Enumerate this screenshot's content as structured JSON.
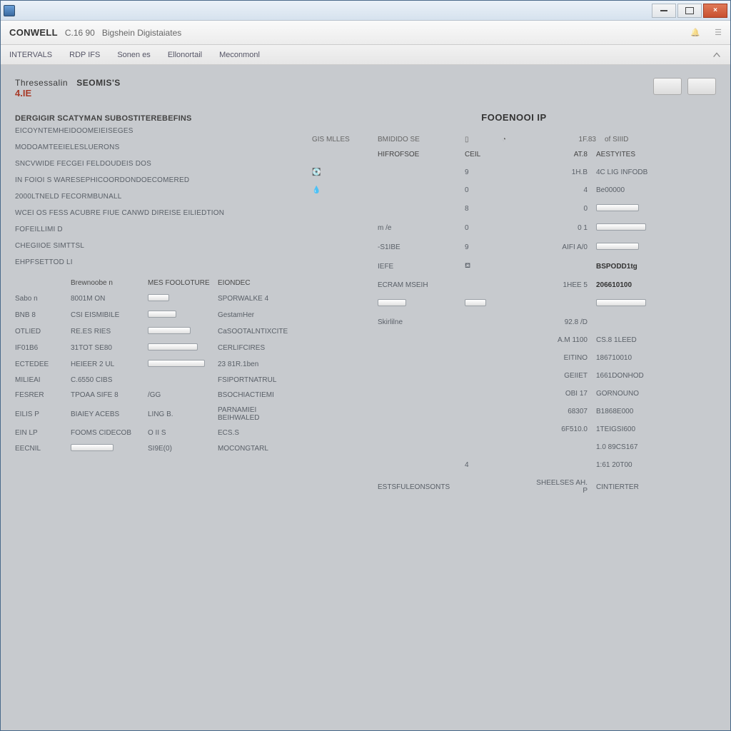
{
  "window": {
    "title": "",
    "titlebar_buttons": {
      "min": "",
      "max": "",
      "close": "×"
    }
  },
  "appheader": {
    "brand": "CONWELL",
    "suffix": "C.16 90",
    "subtitle": "Bigshein Digistaiates"
  },
  "toolstrip": {
    "items": [
      "INTERVALS",
      "RDP IFS",
      "Sonen es",
      "Ellonortail",
      "Meconmonl"
    ]
  },
  "left": {
    "pg_title_a": "Thresessalin",
    "pg_title_b": "SEOMIS'S",
    "accent": "4.IE",
    "section_header": "DERGIGIR  SCATYMAN SUBOSTITEREBEFINS",
    "params": [
      "EICOYNTEMHEIDOOMEIEISEGES",
      "MODOAMTEEIELESLUERONS",
      "SNCVWIDE FECGEI FELDOUDEIS DOS",
      "IN FOIOI S  WARESEPHICOORDONDOECOMERED",
      "2000LTNELD  FECORMBUNALL",
      "WCEI OS  FESS ACUBRE FIUE CANWD  DIREISE EILIEDTION",
      "FOFEILLIMI D",
      "CHEGIIOE SIMTTSL",
      "EHPFSETTOD LI"
    ],
    "table": {
      "headers": [
        "",
        "Brewnoobe n",
        "MES FOOLOTURE",
        "EIONDEC"
      ],
      "rows": [
        {
          "c0": "Sabo n",
          "c1": "8001M ON",
          "c2": "bar-s30",
          "c3": "SPORWALKE 4"
        },
        {
          "c0": "BNB 8",
          "c1": "CSI EISMIBILE",
          "c2": "bar-s40",
          "c3": "GestamHer"
        },
        {
          "c0": "OTLIED",
          "c1": "RE.ES  RIES",
          "c2": "bar-s60",
          "c3": "CaSOOTALNTIXCITE"
        },
        {
          "c0": "IF01B6",
          "c1": "31TOT SE80",
          "c2": "bar-s70",
          "c3": "CERLIFCIRES"
        },
        {
          "c0": "ECTEDEE",
          "c1": "HEIEER  2 UL",
          "c2": "bar-s80",
          "c3": "23 81R.1ben"
        },
        {
          "c0": "MILIEAI",
          "c1": "C.6550  CIBS",
          "c2": "",
          "c3": "FSIPORTNATRUL"
        },
        {
          "c0": "FESRER",
          "c1": "TPOAA  SIFE 8",
          "c2": "/GG",
          "c3": "BSOCHIACTIEMI"
        },
        {
          "c0": "EILIS P",
          "c1": "BIAIEY ACEBS",
          "c2": "LING  B.",
          "c3": "PARNAMIEI BEIHWALED"
        },
        {
          "c0": "EIN LP",
          "c1": "FOOMS CIDECOB",
          "c2": "O II S",
          "c3": "ECS.S"
        },
        {
          "c0": "EECNIL",
          "c1": "",
          "c2": "SI9E(0)",
          "c3": "MOCONGTARL"
        }
      ]
    }
  },
  "right": {
    "heading": "FOOENOOI IP",
    "toprow": {
      "a": "GIS MLLES",
      "b": "BMIDIDO SE",
      "c": "",
      "d": "",
      "e": "1F.83",
      "f": "of SIIID"
    },
    "headers": [
      "",
      "HIFROFSOE",
      "CEIL",
      "AT.8",
      "AESTYITES"
    ],
    "rows": [
      {
        "i": "disk",
        "a": "",
        "b": "9",
        "c": "1H.B",
        "d": "4C LIG INFODB"
      },
      {
        "i": "drop",
        "a": "",
        "b": "0",
        "c": "4",
        "d": "Be00000"
      },
      {
        "i": "",
        "a": "",
        "b": "8",
        "c": "0",
        "d": ""
      },
      {
        "i": "",
        "a": "m /e",
        "b": "0",
        "c": "0 1",
        "d": ""
      },
      {
        "i": "",
        "a": "-S1IBE",
        "b": "9",
        "c": "AIFI A/0",
        "d": ""
      },
      {
        "i": "",
        "a": "IEFE",
        "b": "",
        "c": "",
        "d": "BSPODD1tg"
      },
      {
        "i": "",
        "a": "ECRAM MSEIH",
        "b": "",
        "c": "1HEE 5",
        "d": "206610100"
      },
      {
        "i": "",
        "a": "",
        "b": "",
        "c": "",
        "d": ""
      },
      {
        "i": "",
        "a": "Skirlilne",
        "b": "",
        "c": "92.8 /D",
        "d": ""
      },
      {
        "i": "",
        "a": "",
        "b": "",
        "c": "A.M 1100",
        "d": "CS.8 1LEED"
      },
      {
        "i": "",
        "a": "",
        "b": "",
        "c": "EITINO",
        "d": "186710010"
      },
      {
        "i": "",
        "a": "",
        "b": "",
        "c": "GEIIET",
        "d": "1661DONHOD"
      },
      {
        "i": "",
        "a": "",
        "b": "",
        "c": "OBI 17",
        "d": "GORNOUNO"
      },
      {
        "i": "",
        "a": "",
        "b": "",
        "c": "68307",
        "d": "B1868E000"
      },
      {
        "i": "",
        "a": "",
        "b": "",
        "c": "6F510.0",
        "d": "1TEIGSI600"
      },
      {
        "i": "",
        "a": "",
        "b": "",
        "c": "",
        "d": "1.0 89CS167"
      },
      {
        "i": "",
        "a": "",
        "b": "4",
        "c": "",
        "d": "1:61 20T00"
      },
      {
        "i": "",
        "a": "ESTSFULEONSONTS",
        "b": "",
        "c": "SHEELSES AH. P",
        "d": "CINTIERTER"
      }
    ]
  }
}
